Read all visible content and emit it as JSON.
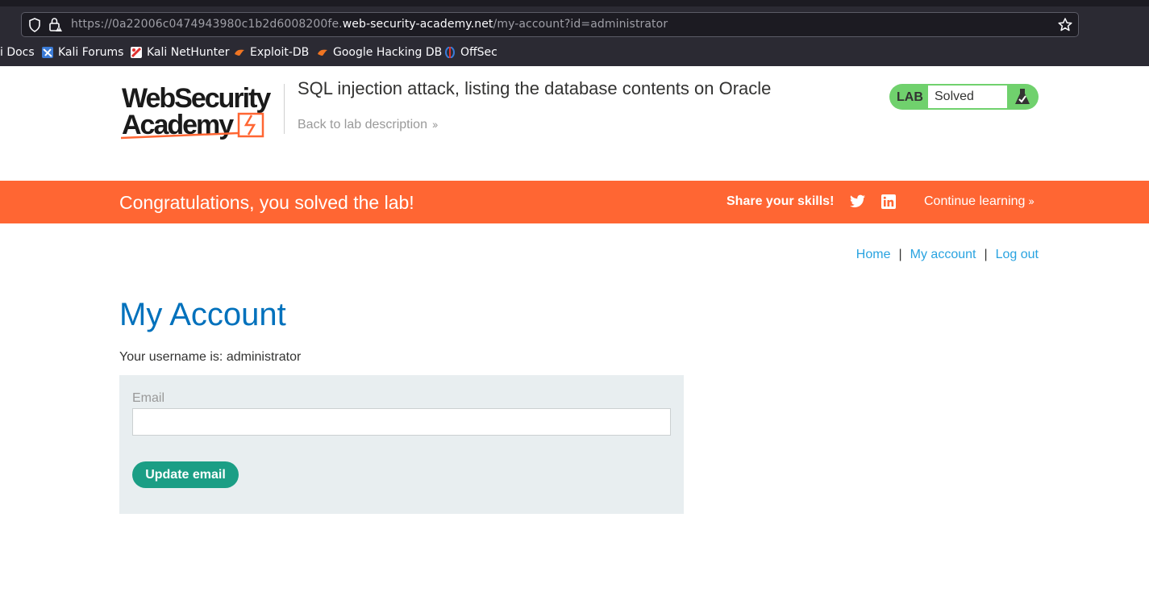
{
  "browser": {
    "url_prefix": "https://0a22006c0474943980c1b2d6008200fe.",
    "url_domain": "web-security-academy.net",
    "url_path": "/my-account?id=administrator",
    "bookmarks": [
      {
        "label": "i Docs",
        "icon": "kali-docs-icon"
      },
      {
        "label": "Kali Forums",
        "icon": "kali-forums-icon"
      },
      {
        "label": "Kali NetHunter",
        "icon": "kali-nethunter-icon"
      },
      {
        "label": "Exploit-DB",
        "icon": "exploit-db-icon"
      },
      {
        "label": "Google Hacking DB",
        "icon": "ghdb-icon"
      },
      {
        "label": "OffSec",
        "icon": "offsec-icon"
      }
    ]
  },
  "header": {
    "logo_line1": "WebSecurity",
    "logo_line2": "Academy",
    "lab_title": "SQL injection attack, listing the database contents on Oracle",
    "back_link": "Back to lab description",
    "lab_badge_word": "LAB",
    "lab_status": "Solved",
    "colors": {
      "badge": "#70d16d",
      "accent": "#ff6633"
    }
  },
  "banner": {
    "message": "Congratulations, you solved the lab!",
    "share_label": "Share your skills!",
    "continue_label": "Continue learning"
  },
  "nav": {
    "home": "Home",
    "sep1": "|",
    "my_account": "My account",
    "sep2": "|",
    "logout": "Log out"
  },
  "main": {
    "title": "My Account",
    "username_line": "Your username is: administrator",
    "email_label": "Email",
    "email_value": "",
    "update_button": "Update email"
  }
}
